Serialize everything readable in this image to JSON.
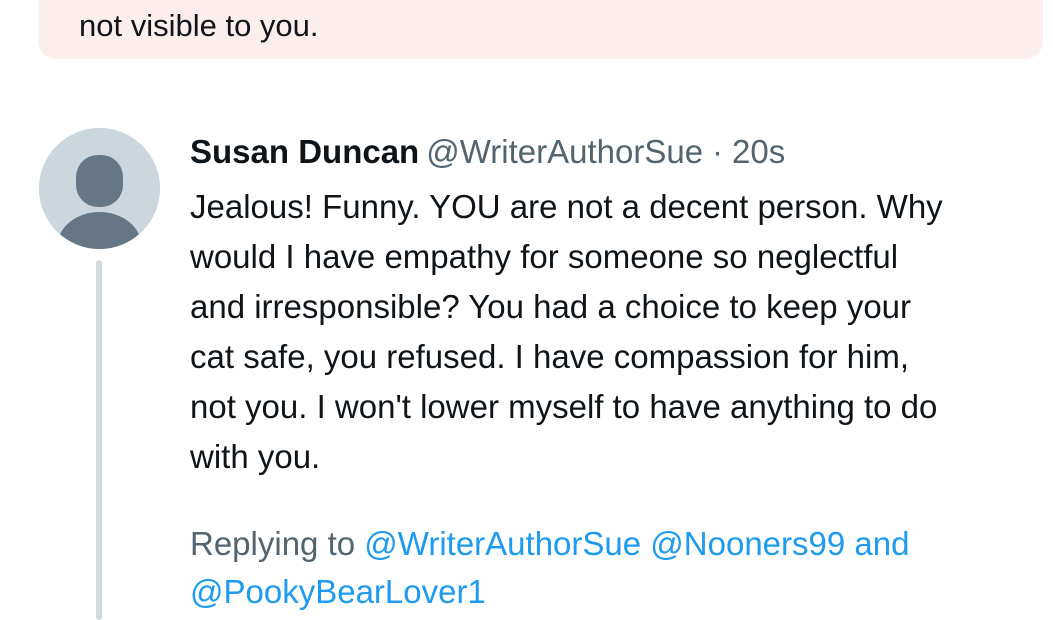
{
  "notice": {
    "text": "not visible to you."
  },
  "tweet": {
    "display_name": "Susan Duncan",
    "handle": "@WriterAuthorSue",
    "separator": "·",
    "timestamp": "20s",
    "body_lines": [
      "Jealous! Funny. YOU are not a decent person. Why",
      "would I have empathy for someone so neglectful",
      "and irresponsible? You had a choice to keep your",
      "cat safe, you refused. I have compassion for him,",
      "not you. I won't lower myself to have anything to do",
      "with you."
    ],
    "replying": {
      "prefix": "Replying to",
      "mention_1": "@WriterAuthorSue",
      "mention_2": "@Nooners99",
      "conjunction": "and",
      "mention_3": "@PookyBearLover1"
    }
  },
  "colors": {
    "notice_bg": "#fdeeee",
    "link": "#1d9bf0",
    "secondary_text": "#536471",
    "avatar_bg": "#ccd6dd",
    "avatar_figure": "#657786",
    "thread_line": "#cfd9de"
  },
  "icons": {
    "avatar": "default-profile-icon"
  }
}
